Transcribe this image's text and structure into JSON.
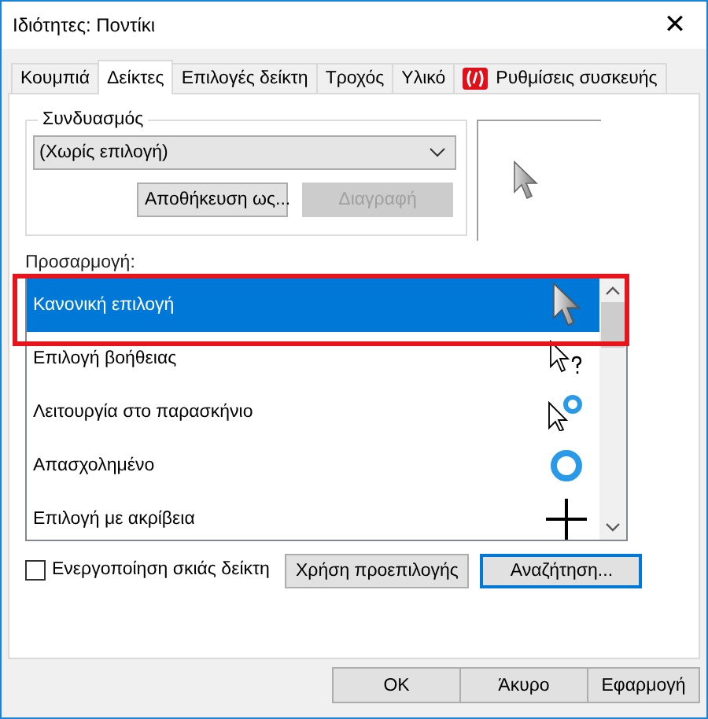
{
  "window": {
    "title": "Ιδιότητες: Ποντίκι",
    "close": "✕"
  },
  "tabs": [
    {
      "label": "Κουμπιά",
      "selected": false
    },
    {
      "label": "Δείκτες",
      "selected": true
    },
    {
      "label": "Επιλογές δείκτη",
      "selected": false
    },
    {
      "label": "Τροχός",
      "selected": false
    },
    {
      "label": "Υλικό",
      "selected": false
    },
    {
      "label": "Ρυθμίσεις συσκευής",
      "selected": false,
      "icon": true
    }
  ],
  "scheme": {
    "legend": "Συνδυασμός",
    "value": "(Χωρίς επιλογή)",
    "buttons": [
      {
        "label": "Αποθήκευση ως...",
        "disabled": false
      },
      {
        "label": "Διαγραφή",
        "disabled": true
      }
    ]
  },
  "customize": {
    "label": "Προσαρμογή:",
    "rows": [
      {
        "name": "Κανονική επιλογή",
        "kind": "arrow",
        "selected": true
      },
      {
        "name": "Επιλογή βοήθειας",
        "kind": "help",
        "selected": false
      },
      {
        "name": "Λειτουργία στο παρασκήνιο",
        "kind": "working",
        "selected": false
      },
      {
        "name": "Απασχολημένο",
        "kind": "busy",
        "selected": false
      },
      {
        "name": "Επιλογή με ακρίβεια",
        "kind": "precision",
        "selected": false
      }
    ]
  },
  "shadow": {
    "label": "Ενεργοποίηση σκιάς δείκτη",
    "checked": false
  },
  "actions": [
    {
      "label": "Χρήση προεπιλογής",
      "focused": false
    },
    {
      "label": "Αναζήτηση...",
      "focused": true
    }
  ],
  "footer": [
    "OK",
    "Άκυρο",
    "Εφαρμογή"
  ]
}
